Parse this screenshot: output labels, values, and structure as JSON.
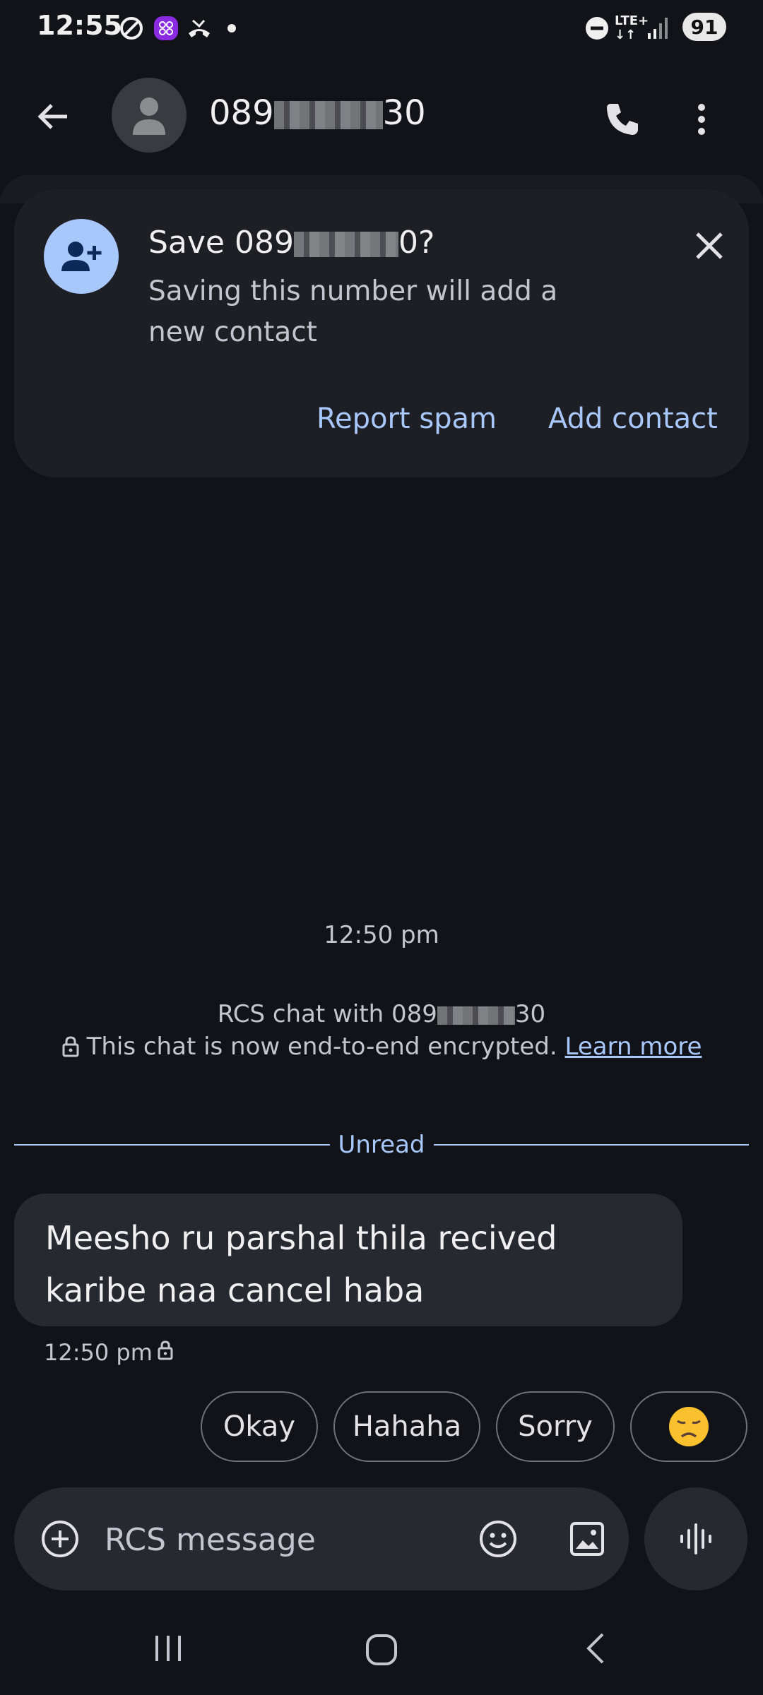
{
  "status_bar": {
    "time": "12:55",
    "battery": "91",
    "network": "LTE+"
  },
  "header": {
    "number_prefix": "089",
    "number_suffix": "30"
  },
  "save_card": {
    "title_prefix": "Save 089",
    "title_suffix": "0?",
    "subtitle": "Saving this number will add a new contact",
    "report_spam_label": "Report spam",
    "add_contact_label": "Add contact"
  },
  "conversation": {
    "time": "12:50 pm",
    "rcs_prefix": "RCS chat with 089",
    "rcs_suffix": "30",
    "encryption_text": "This chat is now end-to-end encrypted.",
    "learn_more_label": "Learn more",
    "unread_label": "Unread",
    "messages": [
      {
        "text": "Meesho ru parshal thila recived karibe naa cancel haba",
        "time": "12:50 pm"
      }
    ]
  },
  "smart_replies": [
    "Okay",
    "Hahaha",
    "Sorry",
    "😞"
  ],
  "compose": {
    "placeholder": "RCS message"
  },
  "colors": {
    "background": "#121318",
    "card": "#1e1f25",
    "bubble": "#272930",
    "accent": "#a8c7fa"
  },
  "icons": [
    "back-icon",
    "person-icon",
    "phone-icon",
    "more-vert-icon",
    "person-add-icon",
    "close-icon",
    "lock-icon",
    "add-circle-icon",
    "emoji-icon",
    "image-icon",
    "voice-wave-icon",
    "nav-recents-icon",
    "nav-home-icon",
    "nav-back-icon"
  ]
}
